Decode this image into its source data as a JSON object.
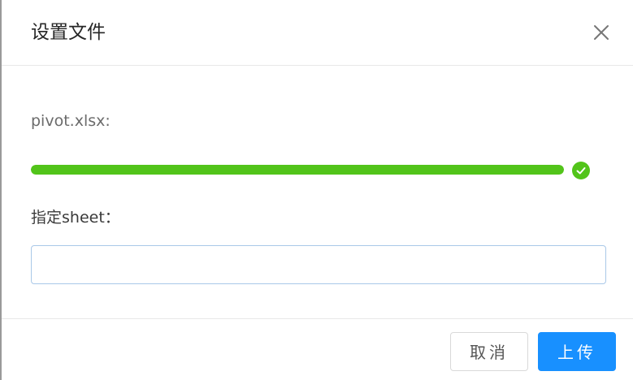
{
  "dialog": {
    "title": "设置文件"
  },
  "upload": {
    "file_name": "pivot.xlsx:",
    "progress_percent": 100,
    "status": "success"
  },
  "sheet": {
    "label": "指定sheet：",
    "value": "",
    "placeholder": ""
  },
  "footer": {
    "cancel_label": "取消",
    "upload_label": "上传"
  },
  "colors": {
    "success": "#52c41a",
    "primary": "#1890ff",
    "input_border": "#a9c8e8"
  },
  "icons": {
    "close": "close-icon",
    "status": "check-circle-icon"
  }
}
